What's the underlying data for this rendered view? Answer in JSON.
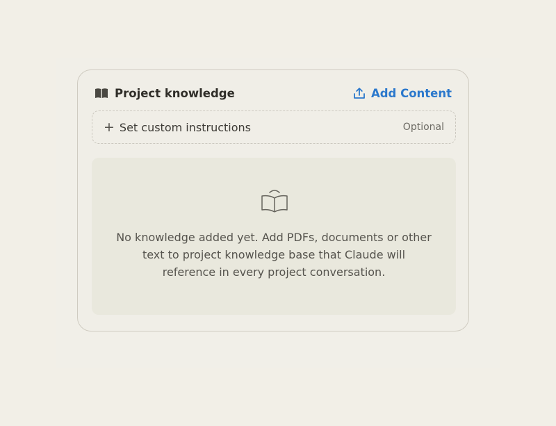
{
  "card": {
    "title": "Project knowledge",
    "title_icon": "book-icon",
    "add_content_label": "Add Content",
    "add_content_icon": "upload-icon",
    "accent_color": "#2b78cc"
  },
  "instructions": {
    "icon": "plus-icon",
    "label": "Set custom instructions",
    "optional_label": "Optional"
  },
  "empty_state": {
    "icon": "open-book-icon",
    "line1": "No knowledge added yet. Add PDFs, documents or other",
    "line2": "text to project knowledge base that Claude will",
    "line3": "reference in every project conversation."
  }
}
